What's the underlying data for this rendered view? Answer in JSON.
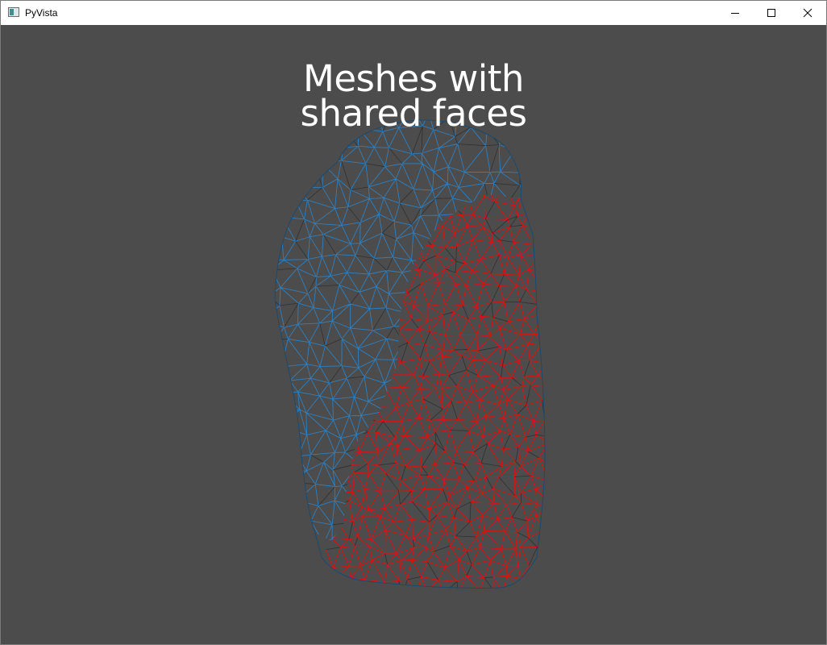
{
  "window": {
    "title": "PyVista",
    "icon": "pyvista-app-icon",
    "controls": [
      "minimize-icon",
      "maximize-icon",
      "close-icon"
    ]
  },
  "scene": {
    "title_line1": "Meshes with",
    "title_line2": "shared faces",
    "background_color": "#4c4c4c",
    "meshes": [
      {
        "style": "wireframe",
        "color": "#2f7fbf"
      },
      {
        "style": "wireframe",
        "color": "#e01010"
      }
    ]
  }
}
